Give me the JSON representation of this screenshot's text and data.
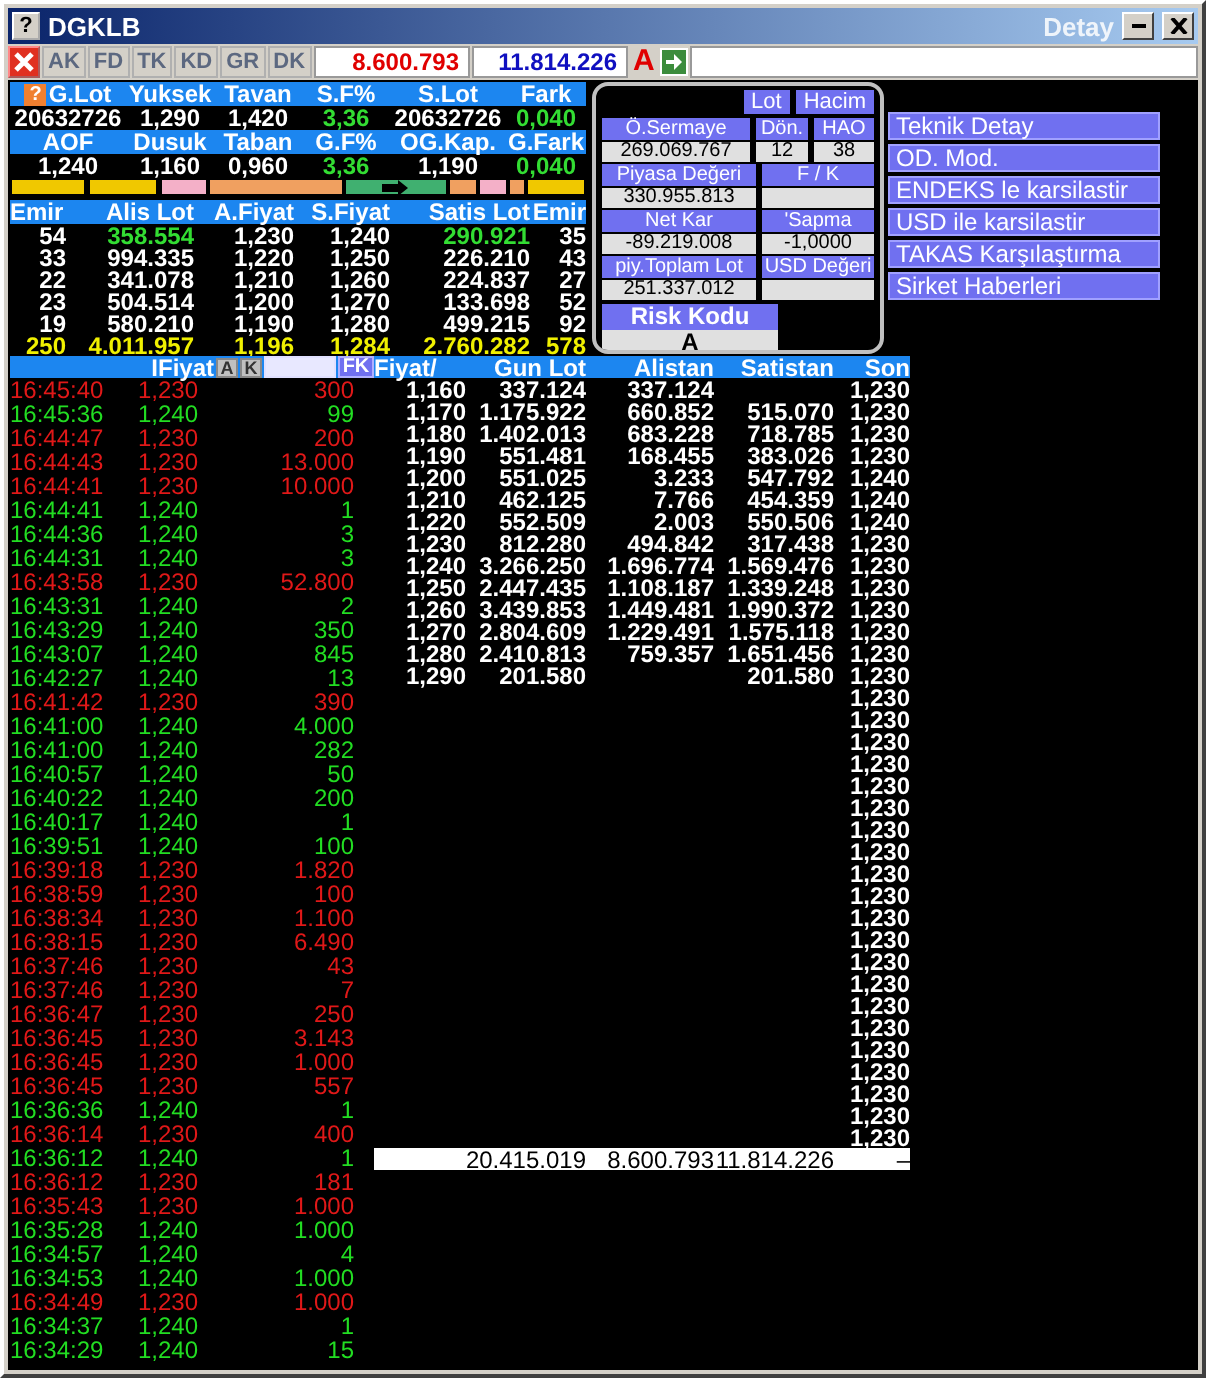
{
  "window": {
    "icon": "?",
    "title": "DGKLB",
    "detail": "Detay"
  },
  "toolbar": {
    "buttons": [
      {
        "label": "AK",
        "disabled": true
      },
      {
        "label": "FD",
        "disabled": true
      },
      {
        "label": "TK",
        "disabled": true
      },
      {
        "label": "KD",
        "disabled": true
      },
      {
        "label": "GR",
        "disabled": true
      },
      {
        "label": "DK",
        "disabled": true
      }
    ],
    "value_1": "8.600.793",
    "value_2": "11.814.226",
    "flag": "A"
  },
  "stats": {
    "corner": "?",
    "rows": [
      [
        {
          "label": "G.Lot",
          "value": "20632726",
          "up": false
        },
        {
          "label": "Yuksek",
          "value": "1,290",
          "up": false
        },
        {
          "label": "Tavan",
          "value": "1,420",
          "up": false
        },
        {
          "label": "S.F%",
          "value": "3,36",
          "up": true
        },
        {
          "label": "S.Lot",
          "value": "20632726",
          "up": false
        },
        {
          "label": "Fark",
          "value": "0,040",
          "up": true
        }
      ],
      [
        {
          "label": "AOF",
          "value": "1,240",
          "up": false
        },
        {
          "label": "Dusuk",
          "value": "1,160",
          "up": false
        },
        {
          "label": "Taban",
          "value": "0,960",
          "up": false
        },
        {
          "label": "G.F%",
          "value": "3,36",
          "up": true
        },
        {
          "label": "OG.Kap.",
          "value": "1,190",
          "up": false
        },
        {
          "label": "G.Fark",
          "value": "0,040",
          "up": true
        }
      ]
    ]
  },
  "order_book": {
    "columns": [
      "Emir",
      "Alis Lot",
      "A.Fiyat",
      "S.Fiyat",
      "Satis Lot",
      "Emir"
    ],
    "rows": [
      {
        "cells": [
          "54",
          "358.554",
          "1,230",
          "1,240",
          "290.921",
          "35"
        ],
        "highlight": true
      },
      {
        "cells": [
          "33",
          "994.335",
          "1,220",
          "1,250",
          "226.210",
          "43"
        ],
        "highlight": false
      },
      {
        "cells": [
          "22",
          "341.078",
          "1,210",
          "1,260",
          "224.837",
          "27"
        ],
        "highlight": false
      },
      {
        "cells": [
          "23",
          "504.514",
          "1,200",
          "1,270",
          "133.698",
          "52"
        ],
        "highlight": false
      },
      {
        "cells": [
          "19",
          "580.210",
          "1,190",
          "1,280",
          "499.215",
          "92"
        ],
        "highlight": false
      }
    ],
    "totals": [
      "250",
      "4.011.957",
      "1,196",
      "1,284",
      "2.760.282",
      "578"
    ]
  },
  "info_panel": {
    "tabs": [
      {
        "label": "Lot",
        "selected": false
      },
      {
        "label": "Hacim",
        "selected": false
      }
    ],
    "fields": [
      [
        {
          "label": "Ö.Sermaye",
          "value": "269.069.767"
        },
        {
          "label": "Dön.",
          "value": "12"
        },
        {
          "label": "HAO",
          "value": "38"
        }
      ],
      [
        {
          "label": "Piyasa Değeri",
          "value": "330.955.813"
        },
        {
          "label": "F / K"
        }
      ],
      [
        {
          "label": "Net Kar",
          "value": "-89.219.008"
        },
        {
          "label": "'Sapma",
          "value": "-1,0000"
        }
      ],
      [
        {
          "label": "piy.Toplam Lot",
          "value": "251.337.012"
        },
        {
          "label": "USD Değeri"
        }
      ]
    ],
    "risk": {
      "label": "Risk Kodu",
      "value": "A"
    }
  },
  "links": [
    "Teknik Detay",
    "OD. Mod.",
    "ENDEKS le karsilastir",
    "USD ile karsilastir",
    "TAKAS Karşılaştırma",
    "Sirket Haberleri"
  ],
  "trades": {
    "header": "IFiyat",
    "buttons": [
      "A",
      "K"
    ],
    "filter_button": "FK",
    "rows": [
      {
        "time": "16:45:40",
        "price": "1,230",
        "lot": "300",
        "uptick": false
      },
      {
        "time": "16:45:36",
        "price": "1,240",
        "lot": "99",
        "uptick": true
      },
      {
        "time": "16:44:47",
        "price": "1,230",
        "lot": "200",
        "uptick": false
      },
      {
        "time": "16:44:43",
        "price": "1,230",
        "lot": "13.000",
        "uptick": false
      },
      {
        "time": "16:44:41",
        "price": "1,230",
        "lot": "10.000",
        "uptick": false
      },
      {
        "time": "16:44:41",
        "price": "1,240",
        "lot": "1",
        "uptick": true
      },
      {
        "time": "16:44:36",
        "price": "1,240",
        "lot": "3",
        "uptick": true
      },
      {
        "time": "16:44:31",
        "price": "1,240",
        "lot": "3",
        "uptick": true
      },
      {
        "time": "16:43:58",
        "price": "1,230",
        "lot": "52.800",
        "uptick": false
      },
      {
        "time": "16:43:31",
        "price": "1,240",
        "lot": "2",
        "uptick": true
      },
      {
        "time": "16:43:29",
        "price": "1,240",
        "lot": "350",
        "uptick": true
      },
      {
        "time": "16:43:07",
        "price": "1,240",
        "lot": "845",
        "uptick": true
      },
      {
        "time": "16:42:27",
        "price": "1,240",
        "lot": "13",
        "uptick": true
      },
      {
        "time": "16:41:42",
        "price": "1,230",
        "lot": "390",
        "uptick": false
      },
      {
        "time": "16:41:00",
        "price": "1,240",
        "lot": "4.000",
        "uptick": true
      },
      {
        "time": "16:41:00",
        "price": "1,240",
        "lot": "282",
        "uptick": true
      },
      {
        "time": "16:40:57",
        "price": "1,240",
        "lot": "50",
        "uptick": true
      },
      {
        "time": "16:40:22",
        "price": "1,240",
        "lot": "200",
        "uptick": true
      },
      {
        "time": "16:40:17",
        "price": "1,240",
        "lot": "1",
        "uptick": true
      },
      {
        "time": "16:39:51",
        "price": "1,240",
        "lot": "100",
        "uptick": true
      },
      {
        "time": "16:39:18",
        "price": "1,230",
        "lot": "1.820",
        "uptick": false
      },
      {
        "time": "16:38:59",
        "price": "1,230",
        "lot": "100",
        "uptick": false
      },
      {
        "time": "16:38:34",
        "price": "1,230",
        "lot": "1.100",
        "uptick": false
      },
      {
        "time": "16:38:15",
        "price": "1,230",
        "lot": "6.490",
        "uptick": false
      },
      {
        "time": "16:37:46",
        "price": "1,230",
        "lot": "43",
        "uptick": false
      },
      {
        "time": "16:37:46",
        "price": "1,230",
        "lot": "7",
        "uptick": false
      },
      {
        "time": "16:36:47",
        "price": "1,230",
        "lot": "250",
        "uptick": false
      },
      {
        "time": "16:36:45",
        "price": "1,230",
        "lot": "3.143",
        "uptick": false
      },
      {
        "time": "16:36:45",
        "price": "1,230",
        "lot": "1.000",
        "uptick": false
      },
      {
        "time": "16:36:45",
        "price": "1,230",
        "lot": "557",
        "uptick": false
      },
      {
        "time": "16:36:36",
        "price": "1,240",
        "lot": "1",
        "uptick": true
      },
      {
        "time": "16:36:14",
        "price": "1,230",
        "lot": "400",
        "uptick": false
      },
      {
        "time": "16:36:12",
        "price": "1,240",
        "lot": "1",
        "uptick": true
      },
      {
        "time": "16:36:12",
        "price": "1,230",
        "lot": "181",
        "uptick": false
      },
      {
        "time": "16:35:43",
        "price": "1,230",
        "lot": "1.000",
        "uptick": false
      },
      {
        "time": "16:35:28",
        "price": "1,240",
        "lot": "1.000",
        "uptick": true
      },
      {
        "time": "16:34:57",
        "price": "1,240",
        "lot": "4",
        "uptick": true
      },
      {
        "time": "16:34:53",
        "price": "1,240",
        "lot": "1.000",
        "uptick": true
      },
      {
        "time": "16:34:49",
        "price": "1,230",
        "lot": "1.000",
        "uptick": false
      },
      {
        "time": "16:34:37",
        "price": "1,240",
        "lot": "1",
        "uptick": true
      },
      {
        "time": "16:34:29",
        "price": "1,240",
        "lot": "15",
        "uptick": true
      }
    ]
  },
  "depth": {
    "columns": [
      "Fiyat/",
      "Gun Lot",
      "Alistan",
      "Satistan",
      "Son"
    ],
    "rows": [
      {
        "price": "1,160",
        "day_lot": "337.124",
        "bid": "337.124"
      },
      {
        "price": "1,170",
        "day_lot": "1.175.922",
        "bid": "660.852",
        "ask": "515.070"
      },
      {
        "price": "1,180",
        "day_lot": "1.402.013",
        "bid": "683.228",
        "ask": "718.785"
      },
      {
        "price": "1,190",
        "day_lot": "551.481",
        "bid": "168.455",
        "ask": "383.026"
      },
      {
        "price": "1,200",
        "day_lot": "551.025",
        "bid": "3.233",
        "ask": "547.792"
      },
      {
        "price": "1,210",
        "day_lot": "462.125",
        "bid": "7.766",
        "ask": "454.359"
      },
      {
        "price": "1,220",
        "day_lot": "552.509",
        "bid": "2.003",
        "ask": "550.506"
      },
      {
        "price": "1,230",
        "day_lot": "812.280",
        "bid": "494.842",
        "ask": "317.438"
      },
      {
        "price": "1,240",
        "day_lot": "3.266.250",
        "bid": "1.696.774",
        "ask": "1.569.476"
      },
      {
        "price": "1,250",
        "day_lot": "2.447.435",
        "bid": "1.108.187",
        "ask": "1.339.248"
      },
      {
        "price": "1,260",
        "day_lot": "3.439.853",
        "bid": "1.449.481",
        "ask": "1.990.372"
      },
      {
        "price": "1,270",
        "day_lot": "2.804.609",
        "bid": "1.229.491",
        "ask": "1.575.118"
      },
      {
        "price": "1,280",
        "day_lot": "2.410.813",
        "bid": "759.357",
        "ask": "1.651.456"
      },
      {
        "price": "1,290",
        "day_lot": "201.580",
        "ask": "201.580"
      }
    ],
    "last_prices": [
      "1,230",
      "1,230",
      "1,230",
      "1,230",
      "1,240",
      "1,240",
      "1,240",
      "1,230",
      "1,230",
      "1,230",
      "1,230",
      "1,230",
      "1,230",
      "1,230",
      "1,230",
      "1,230",
      "1,230",
      "1,230",
      "1,230",
      "1,230",
      "1,230",
      "1,230",
      "1,230",
      "1,230",
      "1,230",
      "1,230",
      "1,230",
      "1,230",
      "1,230",
      "1,230",
      "1,230",
      "1,230",
      "1,230",
      "1,230",
      "1,230"
    ],
    "summary": [
      "20.415.019",
      "8.600.793",
      "11.814.226",
      "–"
    ]
  }
}
